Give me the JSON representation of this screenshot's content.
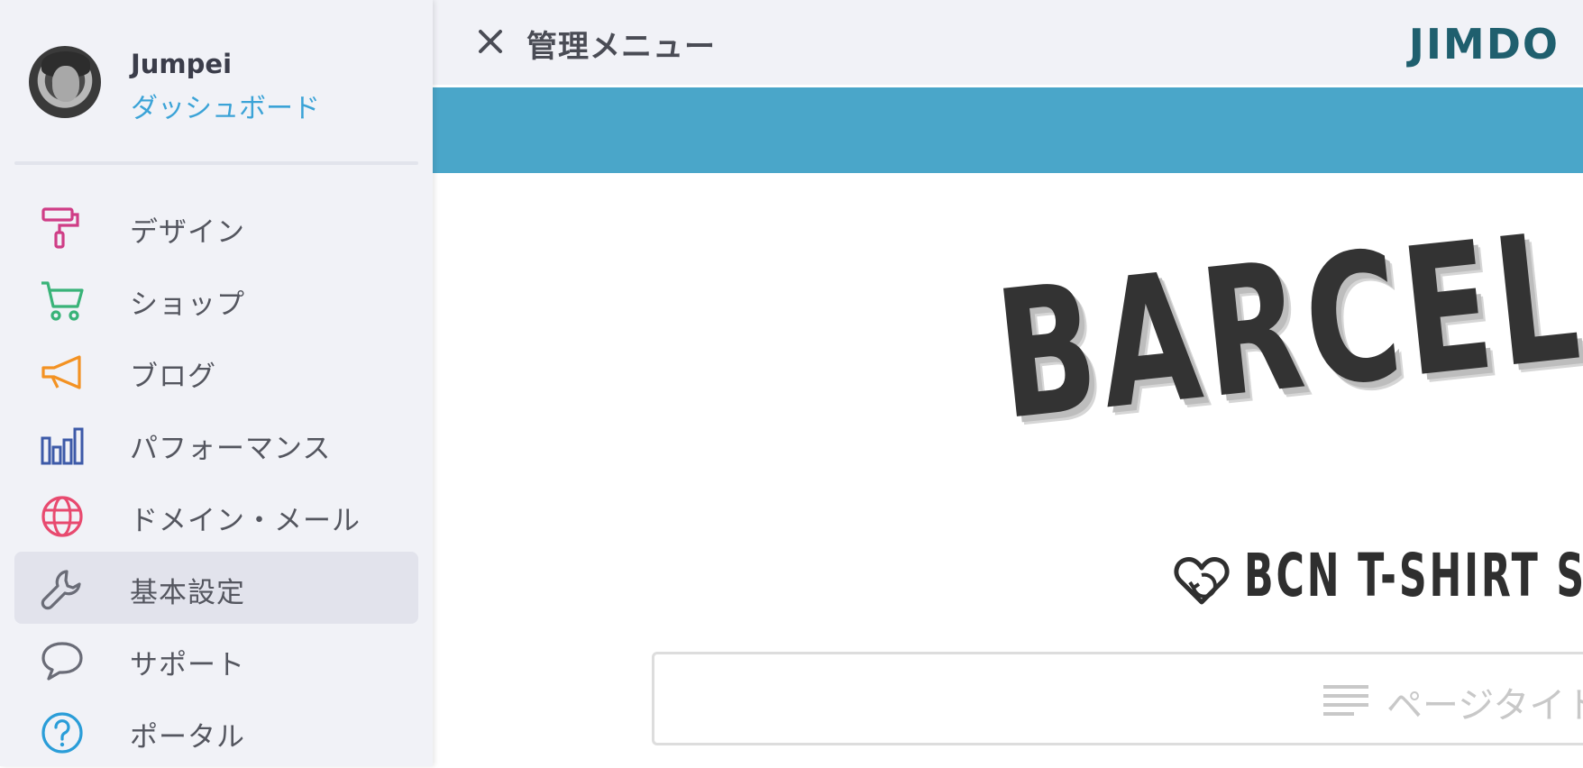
{
  "profile": {
    "name": "Jumpei",
    "link_label": "ダッシュボード"
  },
  "sidebar": {
    "items": [
      {
        "label": "デザイン",
        "icon": "paint-roller-icon",
        "color": "#cf3d86"
      },
      {
        "label": "ショップ",
        "icon": "shopping-cart-icon",
        "color": "#39b378"
      },
      {
        "label": "ブログ",
        "icon": "megaphone-icon",
        "color": "#f39223"
      },
      {
        "label": "パフォーマンス",
        "icon": "bar-chart-icon",
        "color": "#3d5aa8"
      },
      {
        "label": "ドメイン・メール",
        "icon": "globe-icon",
        "color": "#e84a6f"
      },
      {
        "label": "基本設定",
        "icon": "wrench-icon",
        "color": "#6a6c77",
        "active": true
      },
      {
        "label": "サポート",
        "icon": "speech-bubble-icon",
        "color": "#6a6c77"
      },
      {
        "label": "ポータル",
        "icon": "question-circle-icon",
        "color": "#2a9dd8"
      }
    ]
  },
  "topbar": {
    "close_label": "×",
    "title": "管理メニュー",
    "logo": "JIMDO"
  },
  "colors": {
    "accent_blue": "#4aa6c9",
    "link_blue": "#3ba3d7",
    "logo_teal": "#1f5f6e",
    "sidebar_bg": "#f1f2f7"
  },
  "site": {
    "hero_text": "BARCEL",
    "tagline": "BCN T-SHIRT S",
    "page_title_placeholder": "ページタイト"
  }
}
